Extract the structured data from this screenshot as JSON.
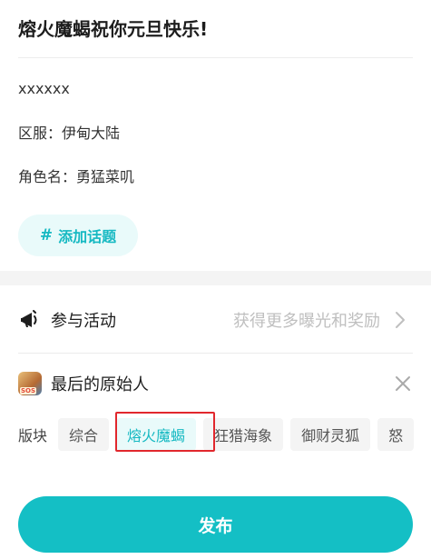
{
  "post": {
    "title": "熔火魔蝎祝你元旦快乐!",
    "body_lines": [
      "xxxxxx",
      "区服：伊甸大陆",
      "角色名：勇猛菜叽"
    ]
  },
  "topic": {
    "hash": "#",
    "label": "添加话题"
  },
  "activity": {
    "icon": "megaphone-icon",
    "label": "参与活动",
    "hint": "获得更多曝光和奖励"
  },
  "game": {
    "name": "最后的原始人",
    "thumb_badge": "SOS"
  },
  "sections": {
    "label": "版块",
    "options": [
      "综合",
      "熔火魔蝎",
      "狂猎海象",
      "御财灵狐",
      "怒"
    ],
    "selected": "熔火魔蝎"
  },
  "publish": {
    "label": "发布"
  },
  "colors": {
    "accent": "#14bfc5",
    "highlight": "#e1272d"
  }
}
